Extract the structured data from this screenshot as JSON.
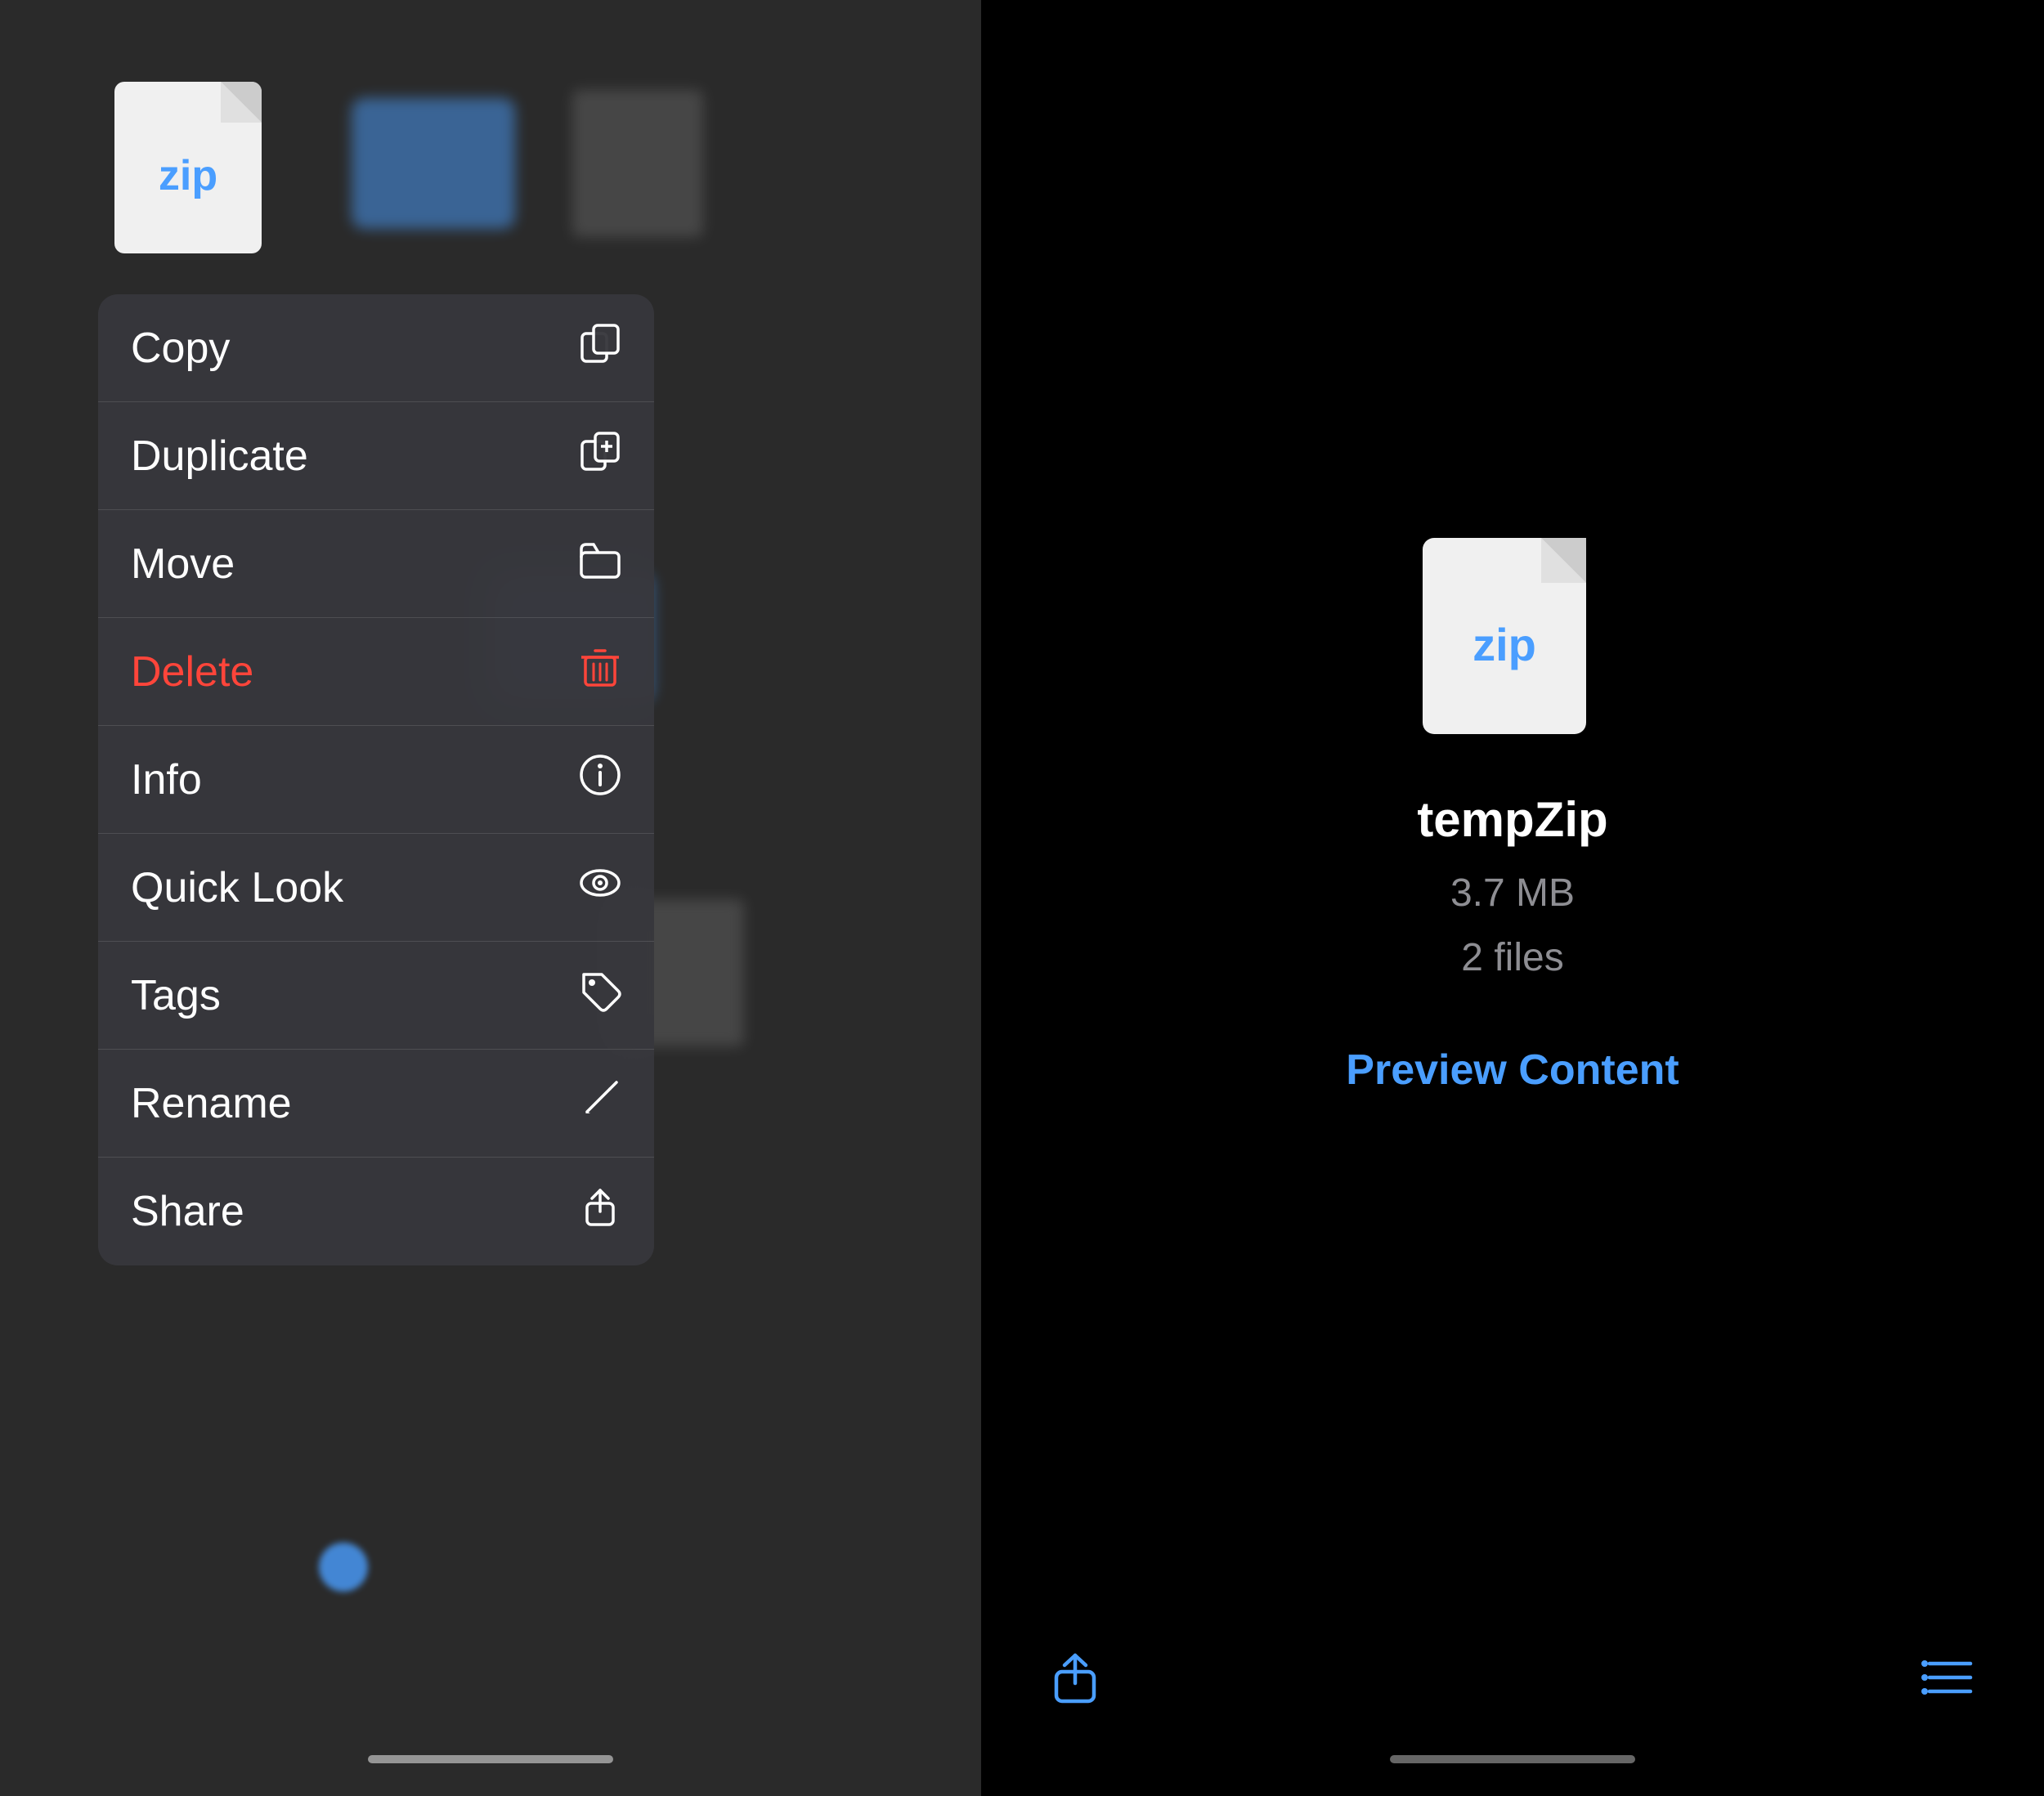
{
  "left": {
    "menu": {
      "items": [
        {
          "id": "copy",
          "label": "Copy",
          "icon": "⧉",
          "color": "normal"
        },
        {
          "id": "duplicate",
          "label": "Duplicate",
          "icon": "⊞",
          "color": "normal"
        },
        {
          "id": "move",
          "label": "Move",
          "icon": "▭",
          "color": "normal"
        },
        {
          "id": "delete",
          "label": "Delete",
          "icon": "🗑",
          "color": "delete"
        },
        {
          "id": "info",
          "label": "Info",
          "icon": "ⓘ",
          "color": "normal"
        },
        {
          "id": "quick-look",
          "label": "Quick Look",
          "icon": "👁",
          "color": "normal"
        },
        {
          "id": "tags",
          "label": "Tags",
          "icon": "◇",
          "color": "normal"
        },
        {
          "id": "rename",
          "label": "Rename",
          "icon": "✎",
          "color": "normal"
        },
        {
          "id": "share",
          "label": "Share",
          "icon": "⬆",
          "color": "normal"
        }
      ]
    }
  },
  "right": {
    "file": {
      "name": "tempZip",
      "size": "3.7 MB",
      "count": "2 files",
      "zip_label": "zip"
    },
    "preview_content_label": "Preview Content",
    "toolbar": {
      "share_icon": "share-icon",
      "list_icon": "list-icon"
    }
  }
}
